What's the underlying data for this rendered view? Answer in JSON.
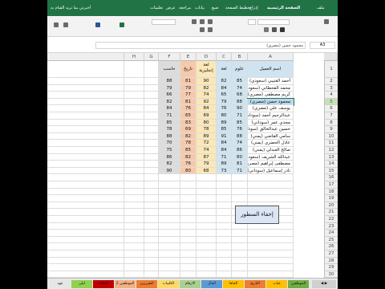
{
  "ribbon": {
    "tabs": [
      "ملف",
      "الصفحة الرئيسية",
      "إدراج",
      "تخطيط الصفحة",
      "صيغ",
      "بيانات",
      "مراجعة",
      "عرض",
      "تعليمات",
      "أخبرني بما تريد القيام به"
    ],
    "accent_color": "#217346"
  },
  "formula_bar": {
    "name_box": "A3",
    "value": "محمود حسن (مصري)"
  },
  "columns": [
    "A",
    "B",
    "C",
    "D",
    "E",
    "F",
    "G",
    "H"
  ],
  "header_row": {
    "row_number": "1",
    "name": "اسم العميل",
    "science": "علوم",
    "arabic": "لغة عربية",
    "english": "لغة إنجليزية",
    "history": "تاريخ",
    "computer": "حاسب"
  },
  "rows": [
    {
      "n": "2",
      "name": "أحمد العتيبي (سعودي)",
      "b": "85",
      "c": "82",
      "d": "90",
      "e": "81",
      "f": "88"
    },
    {
      "n": "3",
      "name": "محمد القحطاني (سعودي)",
      "b": "74",
      "c": "84",
      "d": "82",
      "e": "79",
      "f": "79"
    },
    {
      "n": "4",
      "name": "كريم مصطفى (مصري)",
      "b": "68",
      "c": "65",
      "d": "74",
      "e": "77",
      "f": "66"
    },
    {
      "n": "5",
      "name": "محمود حسن (مصري)",
      "b": "88",
      "c": "79",
      "d": "92",
      "e": "81",
      "f": "82"
    },
    {
      "n": "6",
      "name": "يوسف علي (مصري)",
      "b": "90",
      "c": "76",
      "d": "84",
      "e": "76",
      "f": "84"
    },
    {
      "n": "7",
      "name": "عبدالرحيم أحمد (سوداني)",
      "b": "71",
      "c": "80",
      "d": "69",
      "e": "65",
      "f": "71"
    },
    {
      "n": "8",
      "name": "مجدي عمر (سوداني)",
      "b": "85",
      "c": "89",
      "d": "80",
      "e": "83",
      "f": "85"
    },
    {
      "n": "9",
      "name": "حسين عبدالخالق (سوداني)",
      "b": "76",
      "c": "85",
      "d": "78",
      "e": "69",
      "f": "78"
    },
    {
      "n": "10",
      "name": "سامي القاضي (يمني)",
      "b": "88",
      "c": "91",
      "d": "89",
      "e": "82",
      "f": "88"
    },
    {
      "n": "11",
      "name": "عادل الحضري (يمني)",
      "b": "74",
      "c": "84",
      "d": "72",
      "e": "78",
      "f": "70"
    },
    {
      "n": "12",
      "name": "صالح العبدلي (يمني)",
      "b": "86",
      "c": "84",
      "d": "74",
      "e": "85",
      "f": "75"
    },
    {
      "n": "13",
      "name": "عبدالله الشريف (سعودي)",
      "b": "80",
      "c": "71",
      "d": "87",
      "e": "82",
      "f": "86"
    },
    {
      "n": "14",
      "name": "مصطفى إبراهيم (مصري)",
      "b": "81",
      "c": "89",
      "d": "79",
      "e": "76",
      "f": "82"
    },
    {
      "n": "15",
      "name": "نادر إسماعيل (سوداني)",
      "b": "71",
      "c": "73",
      "d": "68",
      "e": "80",
      "f": "90"
    }
  ],
  "empty_rows": [
    "16",
    "17",
    "18",
    "19",
    "20",
    "21",
    "22",
    "23",
    "24",
    "25",
    "26",
    "27",
    "28",
    "29",
    "30",
    "31"
  ],
  "button": {
    "label": "إخفاء السطور"
  },
  "sheet_tabs": [
    "الموظفين",
    "غياب",
    "التاريخ",
    "الجافا",
    "المال",
    "الارقام",
    "الكلبيات",
    "التقريرين",
    "الموظفين 2",
    "البقالة",
    "ليلى",
    "عهد"
  ],
  "colors": {
    "science": "#cfe4f0",
    "arabic": "#cfe4f0",
    "english": "#fbe7b8",
    "history": "#f7c9ab",
    "computer": "#dcdcdc",
    "header_blue": "#cfe4f0",
    "selected_row": "#b7d6ee"
  }
}
